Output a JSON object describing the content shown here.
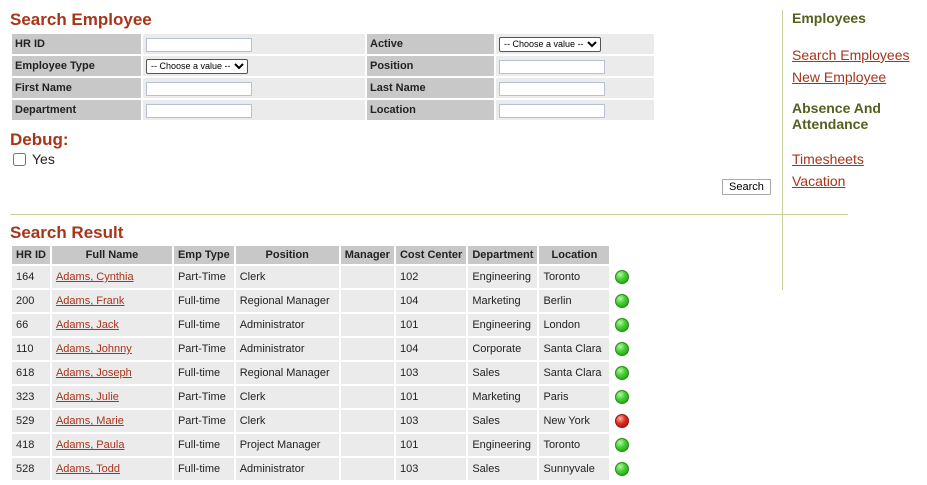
{
  "search": {
    "title": "Search Employee",
    "fields": {
      "hr_id": {
        "label": "HR ID",
        "value": ""
      },
      "active": {
        "label": "Active",
        "selected": "-- Choose a value --"
      },
      "employee_type": {
        "label": "Employee Type",
        "selected": "-- Choose a value --"
      },
      "position": {
        "label": "Position",
        "value": ""
      },
      "first_name": {
        "label": "First Name",
        "value": ""
      },
      "last_name": {
        "label": "Last Name",
        "value": ""
      },
      "department": {
        "label": "Department",
        "value": ""
      },
      "location": {
        "label": "Location",
        "value": ""
      }
    },
    "button_label": "Search"
  },
  "debug": {
    "title": "Debug:",
    "checkbox_label": "Yes",
    "checked": false
  },
  "result": {
    "title": "Search Result",
    "columns": [
      "HR ID",
      "Full Name",
      "Emp Type",
      "Position",
      "Manager",
      "Cost Center",
      "Department",
      "Location"
    ],
    "rows": [
      {
        "hr_id": "164",
        "full_name": "Adams, Cynthia",
        "emp_type": "Part-Time",
        "position": "Clerk",
        "manager": "",
        "cost_center": "102",
        "department": "Engineering",
        "location": "Toronto",
        "status": "green"
      },
      {
        "hr_id": "200",
        "full_name": "Adams, Frank",
        "emp_type": "Full-time",
        "position": "Regional Manager",
        "manager": "",
        "cost_center": "104",
        "department": "Marketing",
        "location": "Berlin",
        "status": "green"
      },
      {
        "hr_id": "66",
        "full_name": "Adams, Jack",
        "emp_type": "Full-time",
        "position": "Administrator",
        "manager": "",
        "cost_center": "101",
        "department": "Engineering",
        "location": "London",
        "status": "green"
      },
      {
        "hr_id": "110",
        "full_name": "Adams, Johnny",
        "emp_type": "Part-Time",
        "position": "Administrator",
        "manager": "",
        "cost_center": "104",
        "department": "Corporate",
        "location": "Santa Clara",
        "status": "green"
      },
      {
        "hr_id": "618",
        "full_name": "Adams, Joseph",
        "emp_type": "Full-time",
        "position": "Regional Manager",
        "manager": "",
        "cost_center": "103",
        "department": "Sales",
        "location": "Santa Clara",
        "status": "green"
      },
      {
        "hr_id": "323",
        "full_name": "Adams, Julie",
        "emp_type": "Part-Time",
        "position": "Clerk",
        "manager": "",
        "cost_center": "101",
        "department": "Marketing",
        "location": "Paris",
        "status": "green"
      },
      {
        "hr_id": "529",
        "full_name": "Adams, Marie",
        "emp_type": "Part-Time",
        "position": "Clerk",
        "manager": "",
        "cost_center": "103",
        "department": "Sales",
        "location": "New York",
        "status": "red"
      },
      {
        "hr_id": "418",
        "full_name": "Adams, Paula",
        "emp_type": "Full-time",
        "position": "Project Manager",
        "manager": "",
        "cost_center": "101",
        "department": "Engineering",
        "location": "Toronto",
        "status": "green"
      },
      {
        "hr_id": "528",
        "full_name": "Adams, Todd",
        "emp_type": "Full-time",
        "position": "Administrator",
        "manager": "",
        "cost_center": "103",
        "department": "Sales",
        "location": "Sunnyvale",
        "status": "green"
      }
    ]
  },
  "sidebar": {
    "sections": [
      {
        "heading": "Employees",
        "links": [
          "Search Employees",
          "New Employee"
        ]
      },
      {
        "heading": "Absence And Attendance",
        "links": [
          "Timesheets",
          "Vacation"
        ]
      }
    ]
  },
  "colors": {
    "heading_red": "#a8341a",
    "sidebar_heading_olive": "#55601f",
    "label_gray": "#c8c8c8",
    "cell_gray": "#ebebeb",
    "status_green": "#3fcf2c",
    "status_red": "#e22a1c"
  }
}
